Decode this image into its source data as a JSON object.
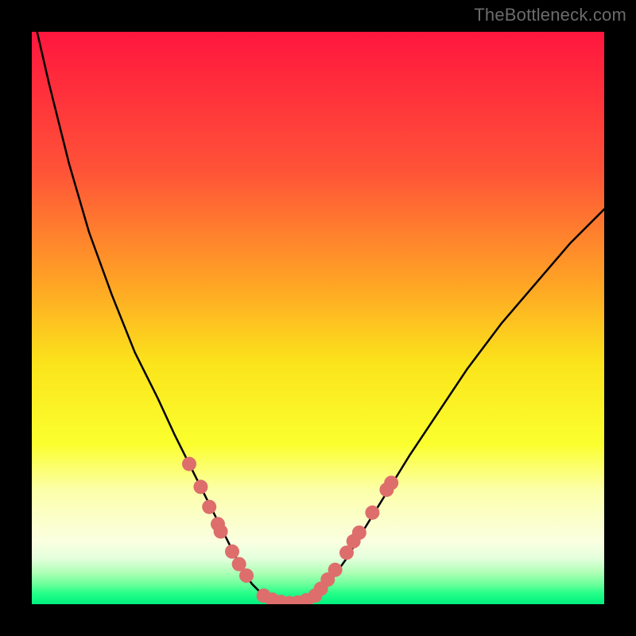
{
  "watermark": "TheBottleneck.com",
  "colors": {
    "frame_bg": "#000000",
    "gradient_stops": [
      {
        "pos": 0,
        "color": "#ff163e"
      },
      {
        "pos": 24,
        "color": "#ff5238"
      },
      {
        "pos": 44,
        "color": "#ffa425"
      },
      {
        "pos": 58,
        "color": "#fbe41b"
      },
      {
        "pos": 72,
        "color": "#fbff2e"
      },
      {
        "pos": 80,
        "color": "#fcffa8"
      },
      {
        "pos": 85,
        "color": "#fbffc9"
      },
      {
        "pos": 89,
        "color": "#faffe0"
      },
      {
        "pos": 92,
        "color": "#e4ffdc"
      },
      {
        "pos": 94.5,
        "color": "#aeffb6"
      },
      {
        "pos": 96.5,
        "color": "#6cff9b"
      },
      {
        "pos": 98,
        "color": "#28ff8a"
      },
      {
        "pos": 100,
        "color": "#00f07e"
      }
    ],
    "curve": "#000000",
    "marker": "#dd6e6c"
  },
  "chart_data": {
    "type": "line",
    "title": "",
    "xlabel": "",
    "ylabel": "",
    "xlim": [
      0,
      100
    ],
    "ylim": [
      0,
      100
    ],
    "note": "Axes are not labeled in the source image. x/y are in percent of plot area estimated from pixel positions.",
    "series": [
      {
        "name": "bottleneck-curve",
        "x": [
          0,
          3,
          6.5,
          10,
          14,
          18,
          22,
          25,
          28,
          30.5,
          32.5,
          34,
          35.5,
          37,
          38.5,
          40,
          42,
          44,
          46,
          48,
          50,
          52.5,
          55,
          58,
          62,
          66,
          71,
          76,
          82,
          88,
          94,
          100
        ],
        "y": [
          104,
          91,
          77,
          65,
          54,
          44,
          36,
          29.5,
          23.5,
          18.5,
          14.5,
          11.5,
          8.5,
          5.5,
          3.5,
          2,
          0.8,
          0.3,
          0.2,
          0.7,
          2,
          4.5,
          8,
          13,
          19.5,
          26,
          33.5,
          41,
          49,
          56,
          63,
          69
        ]
      }
    ],
    "markers": [
      {
        "x": 27.5,
        "y": 24.5
      },
      {
        "x": 29.5,
        "y": 20.5
      },
      {
        "x": 31,
        "y": 17
      },
      {
        "x": 32.5,
        "y": 14
      },
      {
        "x": 33,
        "y": 12.7
      },
      {
        "x": 35,
        "y": 9.2
      },
      {
        "x": 36.2,
        "y": 7
      },
      {
        "x": 37.5,
        "y": 5
      },
      {
        "x": 40.5,
        "y": 1.5
      },
      {
        "x": 42,
        "y": 0.8
      },
      {
        "x": 43.5,
        "y": 0.4
      },
      {
        "x": 45,
        "y": 0.2
      },
      {
        "x": 46.5,
        "y": 0.3
      },
      {
        "x": 48,
        "y": 0.7
      },
      {
        "x": 49.5,
        "y": 1.5
      },
      {
        "x": 50.5,
        "y": 2.7
      },
      {
        "x": 51.7,
        "y": 4.3
      },
      {
        "x": 53,
        "y": 6
      },
      {
        "x": 55,
        "y": 9
      },
      {
        "x": 56.2,
        "y": 11
      },
      {
        "x": 57.2,
        "y": 12.5
      },
      {
        "x": 59.5,
        "y": 16
      },
      {
        "x": 62,
        "y": 20
      },
      {
        "x": 62.8,
        "y": 21.2
      }
    ]
  }
}
